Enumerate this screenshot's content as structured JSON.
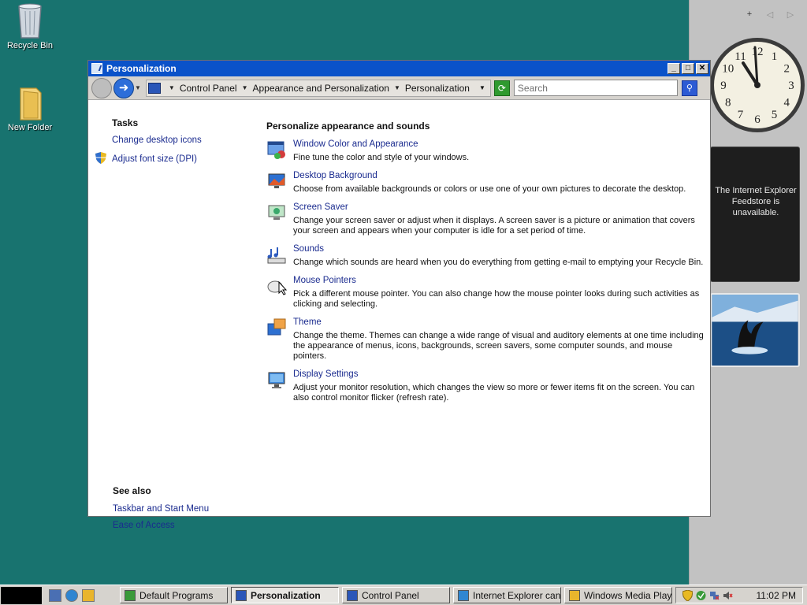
{
  "desktop": {
    "icons": [
      {
        "label": "Recycle Bin",
        "icon": "recycle-bin-icon"
      },
      {
        "label": "New Folder",
        "icon": "folder-icon"
      }
    ]
  },
  "sidebar": {
    "controls": {
      "add": "+",
      "prev": "◁",
      "next": "▷"
    },
    "clock": {
      "numbers": [
        "12",
        "1",
        "2",
        "3",
        "4",
        "5",
        "6",
        "7",
        "8",
        "9",
        "10",
        "11"
      ]
    },
    "feed_lines": [
      "The Internet Explorer",
      "Feedstore is",
      "unavailable."
    ]
  },
  "window": {
    "title": "Personalization",
    "title_buttons": {
      "minimize": "_",
      "maximize": "□",
      "close": "✕"
    },
    "breadcrumbs": [
      "Control Panel",
      "Appearance and Personalization",
      "Personalization"
    ],
    "search_placeholder": "Search",
    "tasks": {
      "heading": "Tasks",
      "links": [
        "Change desktop icons",
        "Adjust font size (DPI)"
      ]
    },
    "see_also": {
      "heading": "See also",
      "links": [
        "Taskbar and Start Menu",
        "Ease of Access"
      ]
    },
    "main": {
      "heading": "Personalize appearance and sounds",
      "items": [
        {
          "title": "Window Color and Appearance",
          "desc": "Fine tune the color and style of your windows.",
          "icon": "window-color-icon"
        },
        {
          "title": "Desktop Background",
          "desc": "Choose from available backgrounds or colors or use one of your own pictures to decorate the desktop.",
          "icon": "desktop-background-icon"
        },
        {
          "title": "Screen Saver",
          "desc": "Change your screen saver or adjust when it displays. A screen saver is a picture or animation that covers your screen and appears when your computer is idle for a set period of time.",
          "icon": "screen-saver-icon"
        },
        {
          "title": "Sounds",
          "desc": "Change which sounds are heard when you do everything from getting e-mail to emptying your Recycle Bin.",
          "icon": "sounds-icon"
        },
        {
          "title": "Mouse Pointers",
          "desc": "Pick a different mouse pointer. You can also change how the mouse pointer looks during such activities as clicking and selecting.",
          "icon": "mouse-pointers-icon"
        },
        {
          "title": "Theme",
          "desc": "Change the theme. Themes can change a wide range of visual and auditory elements at one time including the appearance of menus, icons, backgrounds, screen savers, some computer sounds, and mouse pointers.",
          "icon": "theme-icon"
        },
        {
          "title": "Display Settings",
          "desc": "Adjust your monitor resolution, which changes the view so more or fewer items fit on the screen. You can also control monitor flicker (refresh rate).",
          "icon": "display-settings-icon"
        }
      ]
    }
  },
  "taskbar": {
    "buttons": [
      {
        "label": "Default Programs",
        "active": false,
        "color": "#3a9a3a"
      },
      {
        "label": "Personalization",
        "active": true,
        "color": "#2a56b8"
      },
      {
        "label": "Control Panel",
        "active": false,
        "color": "#2a56b8"
      },
      {
        "label": "Internet Explorer can...",
        "active": false,
        "color": "#2f86d1"
      },
      {
        "label": "Windows Media Player",
        "active": false,
        "color": "#e9b52c"
      }
    ],
    "time": "11:02 PM"
  }
}
